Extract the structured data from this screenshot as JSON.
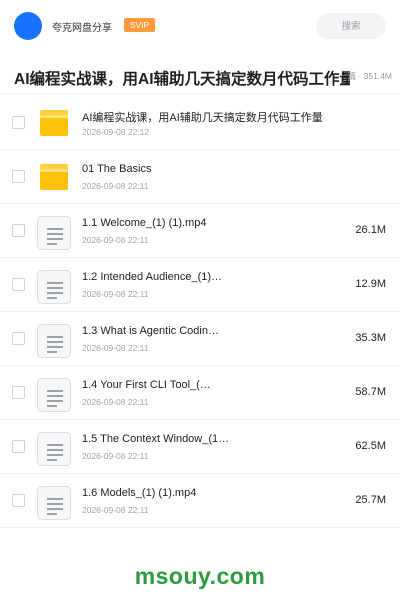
{
  "header": {
    "share_name": "夸克网盘分享",
    "badge": "SVIP",
    "search_placeholder": "搜索"
  },
  "title": {
    "text": "AI编程实战课，用AI辅助几天搞定数月代码工作量",
    "meta": "篇 · 351.4M"
  },
  "items": [
    {
      "type": "folder",
      "name": "AI编程实战课，用AI辅助几天搞定数月代码工作量",
      "date": "2026-09-08 22:12",
      "size": ""
    },
    {
      "type": "folder",
      "name": "01 The Basics",
      "date": "2026-09-08 22:11",
      "size": ""
    },
    {
      "type": "file",
      "name": "1.1 Welcome_(1) (1).mp4",
      "date": "2026-09-08 22:11",
      "size": "26.1M"
    },
    {
      "type": "file",
      "name": "1.2 Intended Audience_(1)…",
      "date": "2026-09-08 22:11",
      "size": "12.9M"
    },
    {
      "type": "file",
      "name": "1.3 What is Agentic Codin…",
      "date": "2026-09-08 22:11",
      "size": "35.3M"
    },
    {
      "type": "file",
      "name": "1.4 Your First CLI Tool_(…",
      "date": "2026-09-08 22:11",
      "size": "58.7M"
    },
    {
      "type": "file",
      "name": "1.5 The Context Window_(1…",
      "date": "2026-09-08 22:11",
      "size": "62.5M"
    },
    {
      "type": "file",
      "name": "1.6 Models_(1) (1).mp4",
      "date": "2026-09-08 22:11",
      "size": "25.7M"
    }
  ],
  "watermark": "msouy.com",
  "colors": {
    "accent": "#1a73ff",
    "svip": "#ff9a3c",
    "folder": "#ffc107",
    "watermark": "#2e9a3e"
  }
}
